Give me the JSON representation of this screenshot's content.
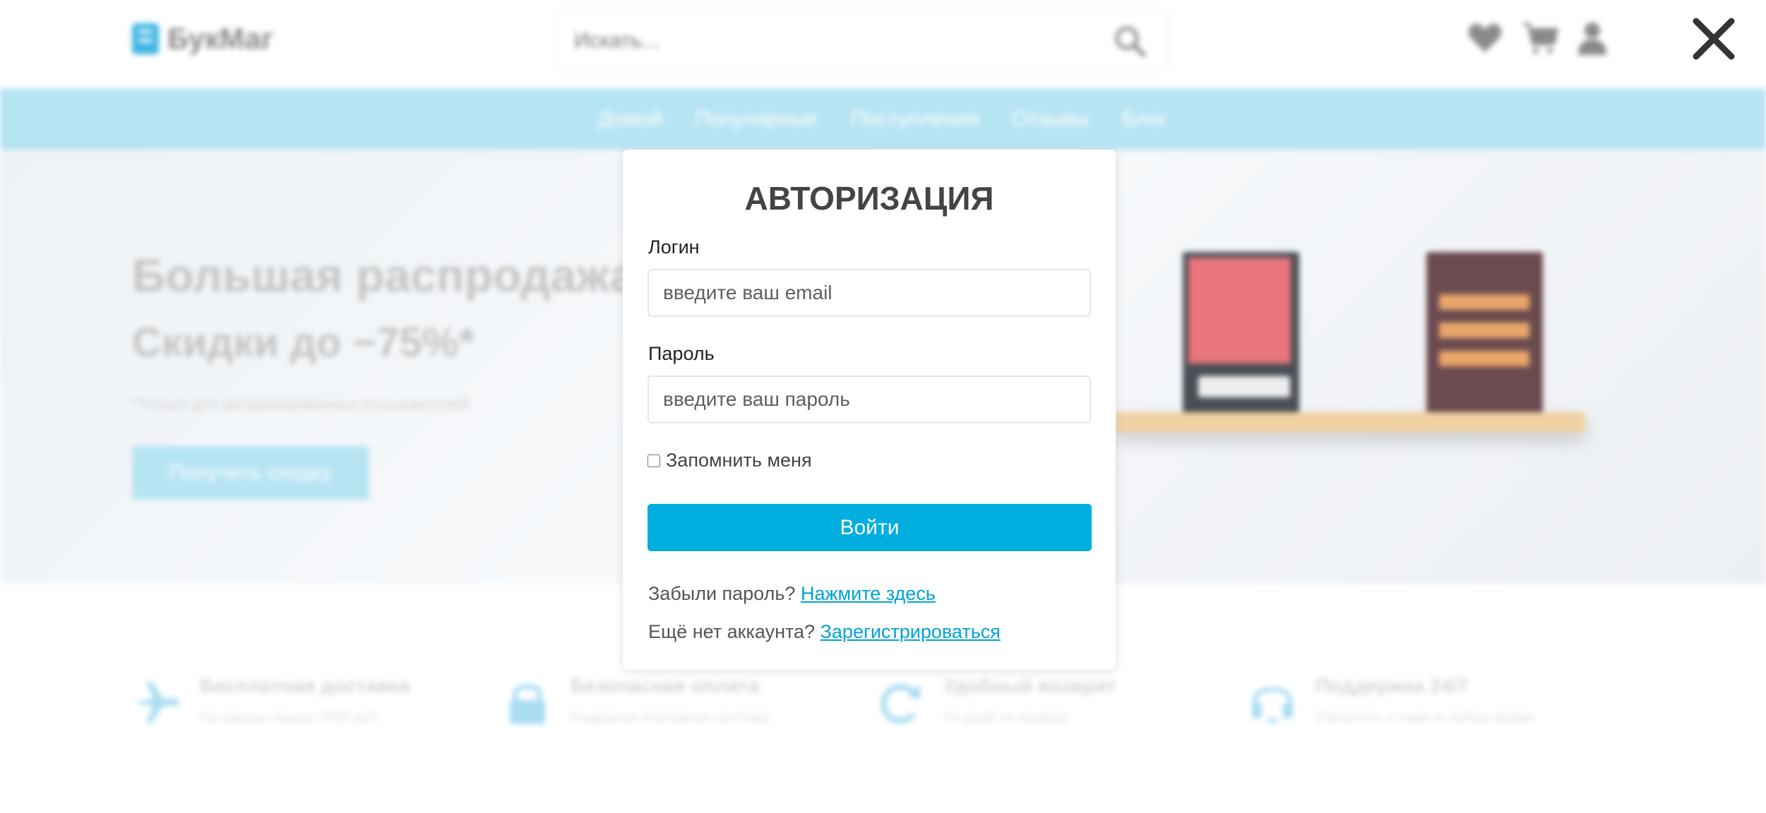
{
  "header": {
    "logo_text": "БукМаг",
    "search_placeholder": "Искать...",
    "icons": [
      "search-icon",
      "heart-icon",
      "cart-icon",
      "user-icon"
    ]
  },
  "nav": {
    "items": [
      "Домой",
      "Популярные",
      "Поступления",
      "Отзывы",
      "Блог"
    ]
  },
  "hero": {
    "title": "Большая распродажа",
    "subtitle": "Скидки до −75%*",
    "note": "*Только для авторизированных пользователей",
    "button": "Получить скидку"
  },
  "features": [
    {
      "icon": "plane-icon",
      "title": "Бесплатная доставка",
      "desc": "На заказы свыше 2000 руб."
    },
    {
      "icon": "lock-icon",
      "title": "Безопасная оплата",
      "desc": "Надежная платежная система"
    },
    {
      "icon": "refresh-icon",
      "title": "Удобный возврат",
      "desc": "14 дней на возврат"
    },
    {
      "icon": "headset-icon",
      "title": "Поддержка 24/7",
      "desc": "Связитесь с нами в любое время"
    }
  ],
  "modal": {
    "title": "АВТОРИЗАЦИЯ",
    "login_label": "Логин",
    "login_placeholder": "введите ваш email",
    "password_label": "Пароль",
    "password_placeholder": "введите ваш пароль",
    "remember_label": "Запомнить меня",
    "submit_label": "Войти",
    "forgot_text": "Забыли пароль?",
    "forgot_link": "Нажмите здесь",
    "register_text": "Ещё нет аккаунта?",
    "register_link": "Зарегистрироваться"
  },
  "colors": {
    "accent": "#00aee0",
    "nav_bg": "#b6e4f3",
    "link": "#00a3d6"
  }
}
